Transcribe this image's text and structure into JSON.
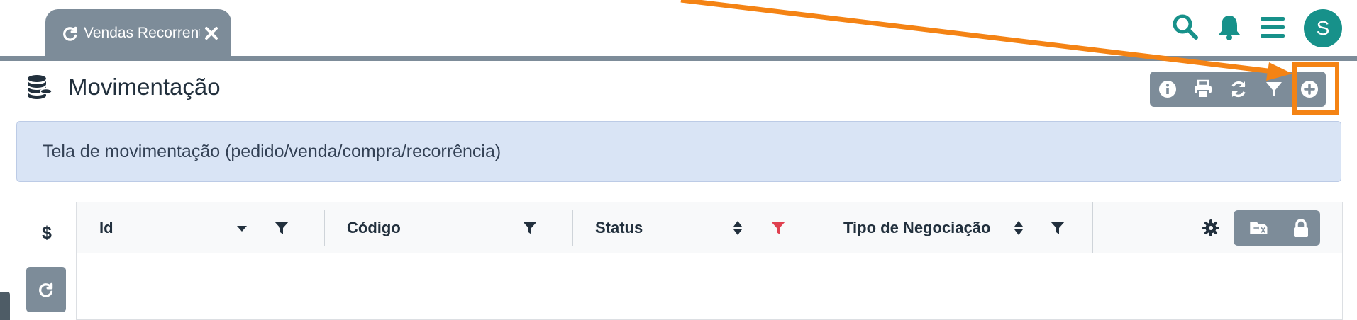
{
  "header": {
    "tab": {
      "label": "Vendas Recorrentes",
      "icon": "refresh-icon",
      "close_icon": "close-icon"
    },
    "icons": [
      "search-icon",
      "bell-icon",
      "menu-icon"
    ],
    "avatar_initial": "S"
  },
  "page": {
    "title": "Movimentação",
    "icon": "database-coins-icon",
    "toolbar": [
      "info-icon",
      "print-icon",
      "refresh-icon",
      "filter-icon",
      "add-circle-icon"
    ]
  },
  "banner": {
    "text": "Tela de movimentação (pedido/venda/compra/recorrência)"
  },
  "side": {
    "currency_symbol": "$",
    "refresh_icon": "refresh-icon"
  },
  "grid": {
    "columns": [
      {
        "label": "Id",
        "sort": "desc",
        "filter_active": false
      },
      {
        "label": "Código",
        "sort": "none",
        "filter_active": false
      },
      {
        "label": "Status",
        "sort": "both",
        "filter_active": true
      },
      {
        "label": "Tipo de Negociação",
        "sort": "both",
        "filter_active": false
      }
    ],
    "tools": [
      "gear-icon",
      "export-excel-icon",
      "lock-icon"
    ]
  },
  "colors": {
    "accent": "#17918a",
    "toolbar": "#7d8c99",
    "highlight": "#f48314",
    "filter_active": "#e0404f"
  }
}
